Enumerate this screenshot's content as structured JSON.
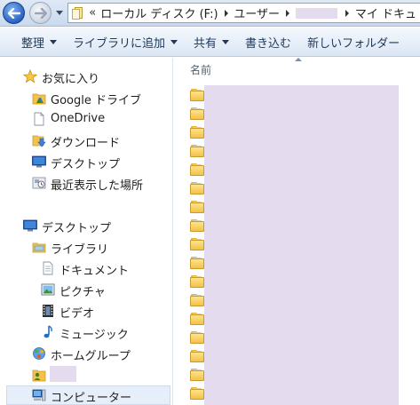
{
  "address": {
    "overflow_chevron": "«",
    "crumbs": [
      "ローカル ディスク (F:)",
      "ユーザー",
      "マイ ドキュ"
    ]
  },
  "toolbar": {
    "organize": "整理",
    "add_to_library": "ライブラリに追加",
    "share": "共有",
    "burn": "書き込む",
    "new_folder": "新しいフォルダー"
  },
  "nav": {
    "favorites": "お気に入り",
    "google_drive": "Google ドライブ",
    "onedrive": "OneDrive",
    "downloads": "ダウンロード",
    "desktop_fav": "デスクトップ",
    "recent": "最近表示した場所",
    "desktop": "デスクトップ",
    "libraries": "ライブラリ",
    "documents": "ドキュメント",
    "pictures": "ピクチャ",
    "videos": "ビデオ",
    "music": "ミュージック",
    "homegroup": "ホームグループ",
    "computer": "コンピューター"
  },
  "filelist": {
    "column_name": "名前",
    "row_count": 17
  }
}
